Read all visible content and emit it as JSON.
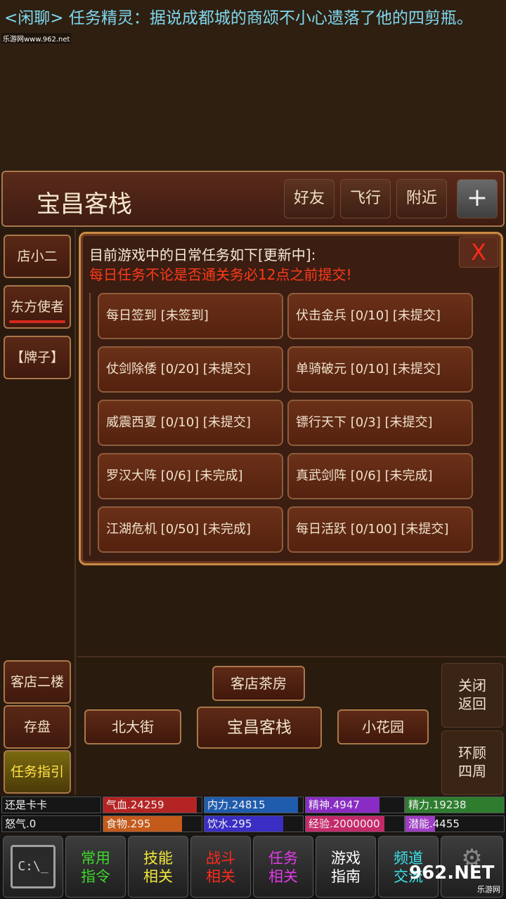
{
  "chat": {
    "line": "<闲聊> 任务精灵：据说成都城的商颂不小心遗落了他的四剪瓶。",
    "watermark": "乐游网www.962.net"
  },
  "location": {
    "title": "宝昌客栈",
    "buttons": [
      "好友",
      "飞行",
      "附近",
      "+"
    ]
  },
  "left_menu": {
    "npcs": [
      "店小二",
      "东方使者",
      "【牌子】"
    ],
    "bottom": [
      "客店二楼",
      "存盘",
      "任务指引"
    ]
  },
  "dialog": {
    "title": "目前游戏中的日常任务如下[更新中]:",
    "warning": "每日任务不论是否通关务必12点之前提交!",
    "close": "X",
    "tasks": [
      "每日签到 [未签到]",
      "伏击金兵 [0/10] [未提交]",
      "仗剑除倭 [0/20] [未提交]",
      "单骑破元 [0/10] [未提交]",
      "威震西夏 [0/10] [未提交]",
      "镖行天下 [0/3] [未提交]",
      "罗汉大阵 [0/6] [未完成]",
      "真武剑阵 [0/6] [未完成]",
      "江湖危机 [0/50] [未完成]",
      "每日活跃 [0/100] [未提交]"
    ]
  },
  "navigation": {
    "north": "客店茶房",
    "west": "北大街",
    "center": "宝昌客栈",
    "east": "小花园",
    "close_return": "关闭 返回",
    "look_around": "环顾 四周"
  },
  "stats": {
    "name": "还是卡卡",
    "hp": "气血.24259",
    "mp": "内力.24815",
    "spirit": "精神.4947",
    "energy": "精力.19238",
    "rage": "怒气.0",
    "food": "食物.295",
    "water": "饮水.295",
    "exp": "经验.2000000",
    "potential": "潜能.4455",
    "colors": {
      "hp": "#b52424",
      "mp": "#1f5cae",
      "spirit": "#8a2cc4",
      "energy": "#2e7d2e",
      "food": "#c45a1a",
      "water": "#3a2ec4",
      "exp": "#c42a6a",
      "potential": "#a03cc4"
    },
    "fill_fraction": {
      "hp": 0.95,
      "mp": 0.95,
      "spirit": 0.75,
      "energy": 1.0,
      "food": 0.8,
      "water": 0.8,
      "exp": 0.8,
      "potential": 0.3
    }
  },
  "bottom_menu": {
    "cmd_icon": "C:\\_",
    "items": [
      {
        "label": "常用 指令",
        "color": "#3fd82c"
      },
      {
        "label": "技能 相关",
        "color": "#f2e83a"
      },
      {
        "label": "战斗 相关",
        "color": "#ff2a1a"
      },
      {
        "label": "任务 相关",
        "color": "#e23ae8"
      },
      {
        "label": "游戏 指南",
        "color": "#ffffff"
      },
      {
        "label": "频道 交流",
        "color": "#3ae2e8"
      }
    ],
    "logo": "962.NET",
    "logo_sub": "乐游网"
  }
}
